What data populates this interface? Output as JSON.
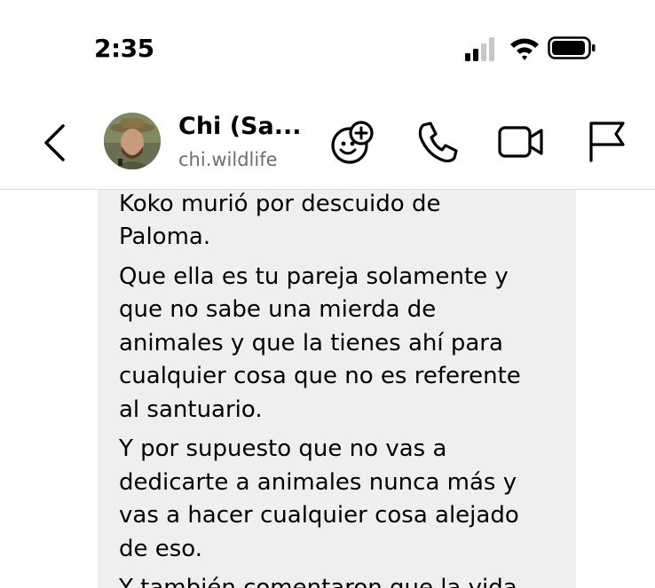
{
  "status_bar": {
    "time": "2:35",
    "signal_bars": 2,
    "wifi": "wifi-icon",
    "battery_level": 0.85
  },
  "header": {
    "back_icon": "chevron-left-icon",
    "contact_name": "Chi (Sa...",
    "contact_username": "chi.wildlife",
    "actions": [
      "add-emoji-icon",
      "phone-icon",
      "video-camera-icon",
      "flag-icon"
    ]
  },
  "message": {
    "paragraphs": [
      "instalaciones deplorables y que\nKoko murió por descuido de\nPaloma.",
      "Que ella es tu pareja solamente y\nque no sabe una mierda de\nanimales y que la tienes ahí para\ncualquier cosa que no es referente\nal santuario.",
      "Y por supuesto que no vas a\ndedicarte a animales nunca más y\nvas a hacer cualquier cosa alejado\nde eso.",
      "Y también comentaron que la vida"
    ]
  },
  "colors": {
    "bubble_bg": "#efefef",
    "secondary_text": "#6d6d72",
    "divider": "#dcdcdc"
  }
}
